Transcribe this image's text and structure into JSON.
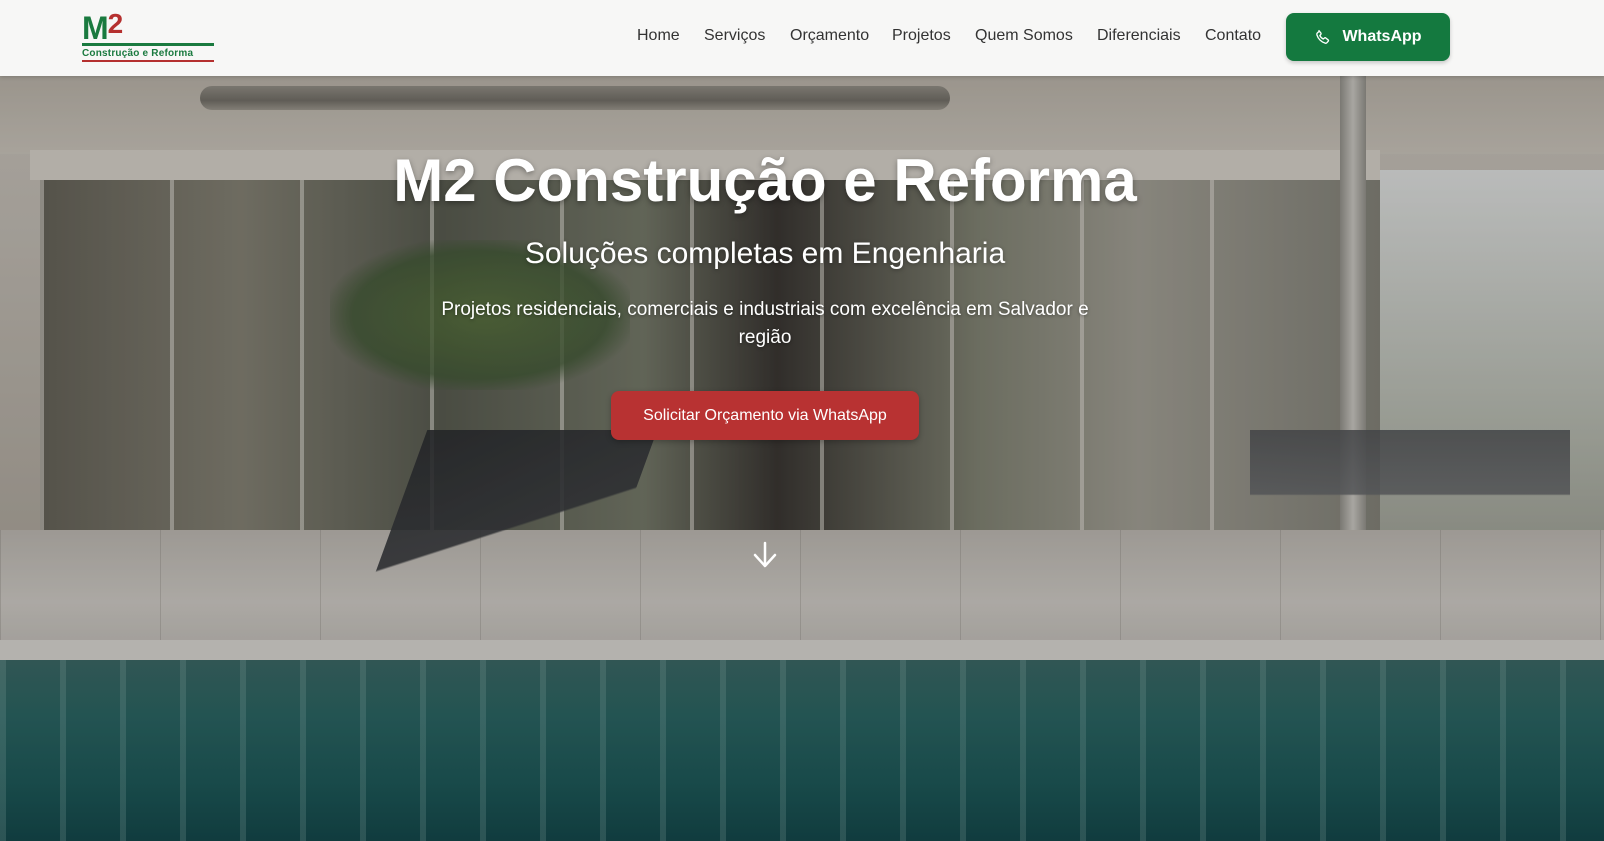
{
  "brand": {
    "logo_mark_m": "M",
    "logo_mark_2": "2",
    "logo_subtitle": "Construção e Reforma"
  },
  "nav": {
    "items": [
      {
        "label": "Home"
      },
      {
        "label": "Serviços"
      },
      {
        "label": "Orçamento"
      },
      {
        "label": "Projetos"
      },
      {
        "label": "Quem Somos"
      },
      {
        "label": "Diferenciais"
      },
      {
        "label": "Contato"
      }
    ],
    "whatsapp_label": "WhatsApp"
  },
  "hero": {
    "title": "M2 Construção e Reforma",
    "subtitle": "Soluções completas em Engenharia",
    "description": "Projetos residenciais, comerciais e industriais com excelência em Salvador e região",
    "cta_label": "Solicitar Orçamento via WhatsApp"
  },
  "colors": {
    "primary_green": "#14793f",
    "cta_red": "#b83232",
    "header_bg": "#fafaf9"
  },
  "icons": {
    "header_button_icon": "phone-icon",
    "scroll_indicator": "arrow-down-icon"
  }
}
